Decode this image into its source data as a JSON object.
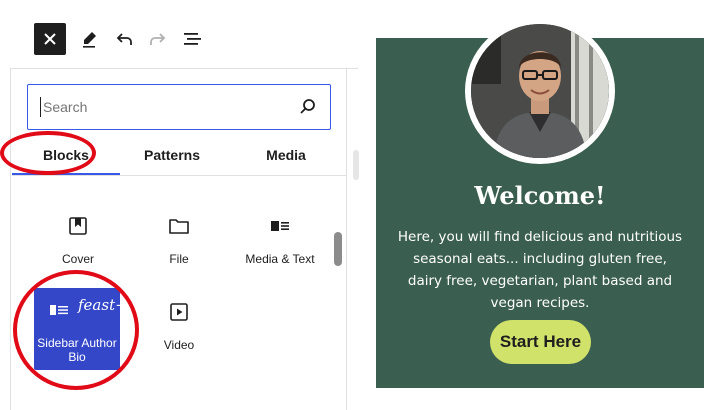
{
  "toolbar": {
    "close_icon": "close-icon",
    "pencil_icon": "pencil-icon",
    "undo_icon": "undo-icon",
    "redo_icon": "redo-icon",
    "list_icon": "list-view-icon"
  },
  "inserter": {
    "search": {
      "placeholder": "Search",
      "icon": "search-icon"
    },
    "tabs": [
      {
        "label": "Blocks",
        "active": true
      },
      {
        "label": "Patterns",
        "active": false
      },
      {
        "label": "Media",
        "active": false
      }
    ],
    "blocks": [
      {
        "label": "Cover",
        "icon": "cover-icon"
      },
      {
        "label": "File",
        "icon": "folder-icon"
      },
      {
        "label": "Media & Text",
        "icon": "media-text-icon"
      },
      {
        "label": "Sidebar Author Bio",
        "icon": "sidebar-author-icon",
        "brand": "feast+",
        "highlighted": true
      },
      {
        "label": "Video",
        "icon": "video-icon"
      }
    ]
  },
  "preview": {
    "title": "Welcome!",
    "description": "Here, you will find delicious and nutritious seasonal eats... including gluten free, dairy free, vegetarian, plant based and vegan recipes.",
    "cta_label": "Start Here",
    "background_color": "#3a5e4f",
    "cta_color": "#d1e26a"
  },
  "colors": {
    "accent": "#3858e9",
    "annotation": "#e10a17",
    "block_highlight": "#3447c8"
  }
}
